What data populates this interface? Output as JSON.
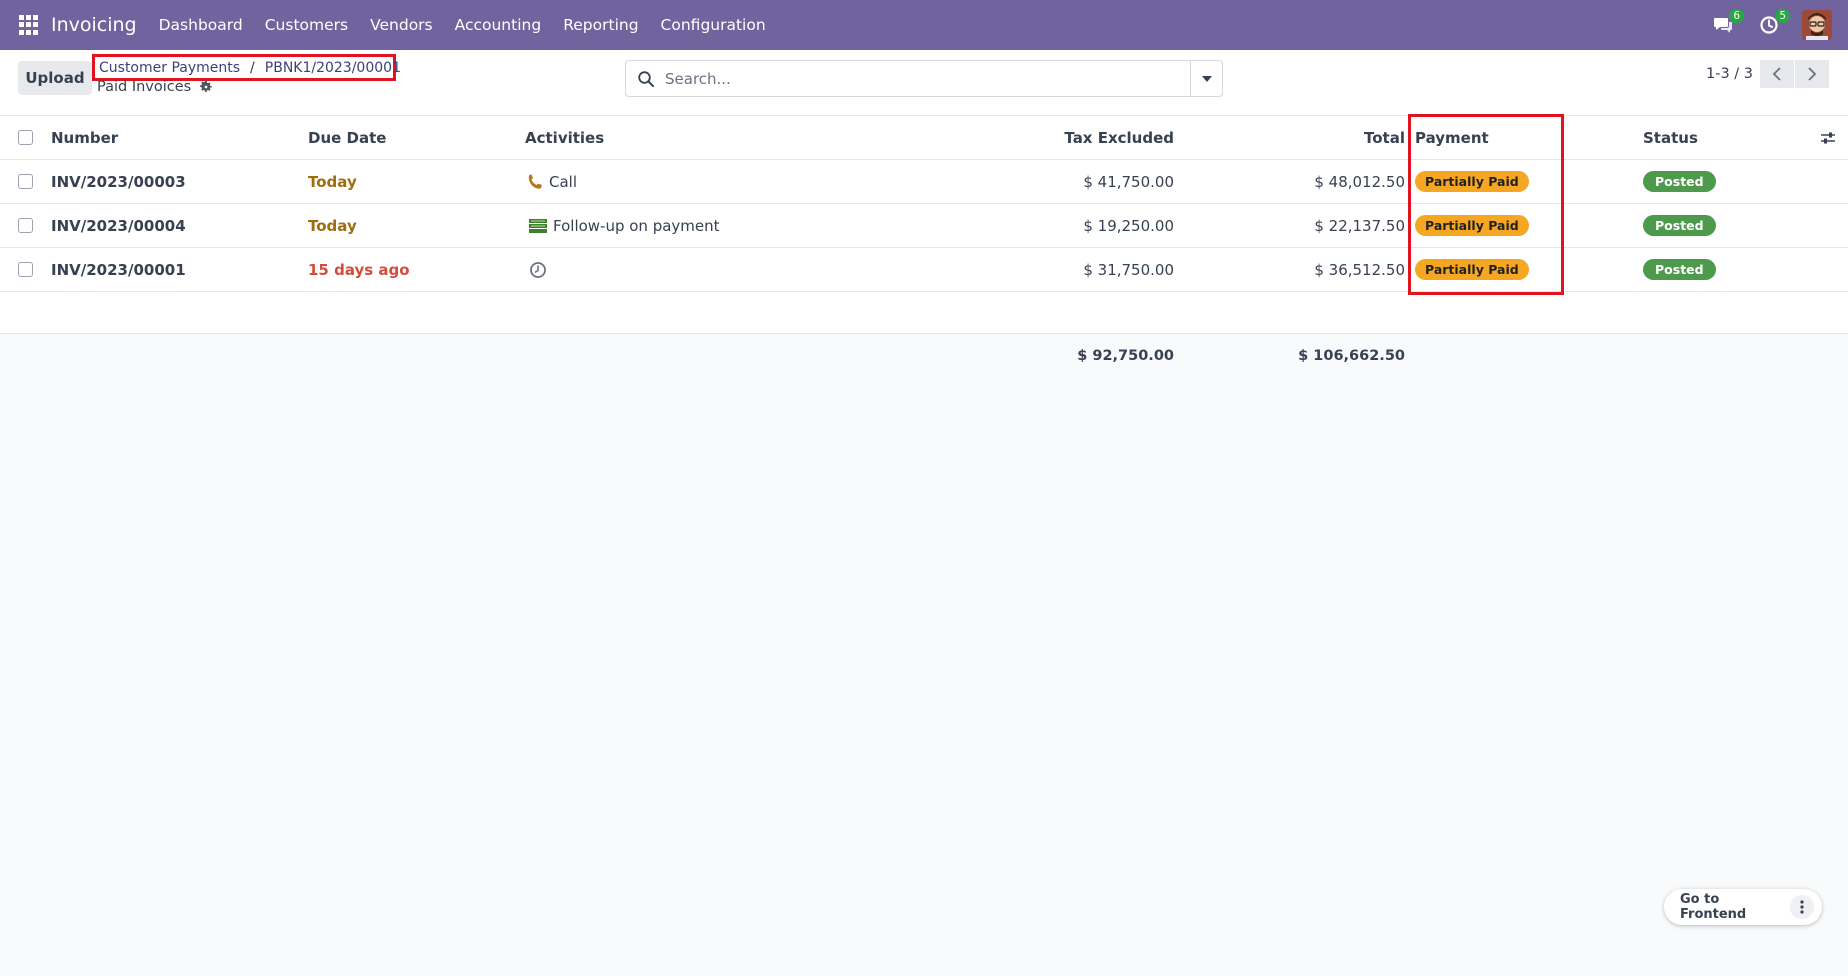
{
  "navbar": {
    "app_name": "Invoicing",
    "menu": [
      "Dashboard",
      "Customers",
      "Vendors",
      "Accounting",
      "Reporting",
      "Configuration"
    ],
    "messages_count": "6",
    "activities_count": "5",
    "color": "#71639e"
  },
  "control_panel": {
    "upload_label": "Upload",
    "breadcrumb": [
      "Customer Payments",
      "PBNK1/2023/00001"
    ],
    "breadcrumb_separator": "/",
    "subtitle": "Paid Invoices",
    "search_placeholder": "Search...",
    "pager": "1-3 / 3"
  },
  "table": {
    "columns": [
      "Number",
      "Due Date",
      "Activities",
      "Tax Excluded",
      "Total",
      "Payment",
      "Status"
    ],
    "rows": [
      {
        "number": "INV/2023/00003",
        "due": "Today",
        "activity_icon": "phone-icon",
        "activity": "Call",
        "tax_excluded": "$ 41,750.00",
        "total": "$ 48,012.50",
        "payment": "Partially Paid",
        "status": "Posted"
      },
      {
        "number": "INV/2023/00004",
        "due": "Today",
        "activity_icon": "money-icon",
        "activity": "Follow-up on payment",
        "tax_excluded": "$ 19,250.00",
        "total": "$ 22,137.50",
        "payment": "Partially Paid",
        "status": "Posted"
      },
      {
        "number": "INV/2023/00001",
        "due": "15 days ago",
        "activity_icon": "clock-icon",
        "activity": "",
        "tax_excluded": "$ 31,750.00",
        "total": "$ 36,512.50",
        "payment": "Partially Paid",
        "status": "Posted"
      }
    ],
    "totals": {
      "tax_excluded": "$ 92,750.00",
      "total": "$ 106,662.50"
    }
  },
  "footer": {
    "frontend_label": "Go to Frontend"
  },
  "colors": {
    "partially_paid": "#f5a623",
    "posted": "#4e9a4c",
    "highlight": "#e0141e"
  }
}
